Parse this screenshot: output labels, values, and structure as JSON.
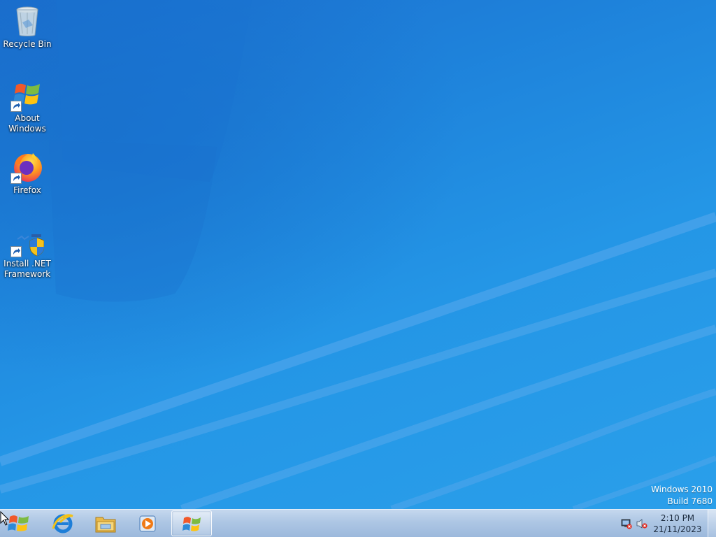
{
  "desktop": {
    "icons": [
      {
        "label": "Recycle Bin",
        "icon": "recycle-bin-icon"
      },
      {
        "label": "About Windows",
        "icon": "windows-logo-icon"
      },
      {
        "label": "Firefox",
        "icon": "firefox-icon"
      },
      {
        "label": "Install .NET Framework",
        "icon": "net-installer-icon"
      }
    ],
    "watermark": {
      "line1": "Windows 2010",
      "line2": "Build 7680"
    }
  },
  "taskbar": {
    "start_icon": "windows-start-orb-icon",
    "pinned": [
      {
        "icon": "internet-explorer-icon",
        "active": false
      },
      {
        "icon": "file-explorer-icon",
        "active": false
      },
      {
        "icon": "media-player-icon",
        "active": false
      },
      {
        "icon": "windows-logo-icon",
        "active": true
      }
    ],
    "tray": {
      "icons": [
        "network-disconnected-icon",
        "volume-muted-icon"
      ],
      "time": "2:10 PM",
      "date": "21/11/2023"
    }
  },
  "colors": {
    "desktop_blue": "#1f86dd",
    "taskbar": "#adc6e4",
    "text_white": "#ffffff"
  }
}
